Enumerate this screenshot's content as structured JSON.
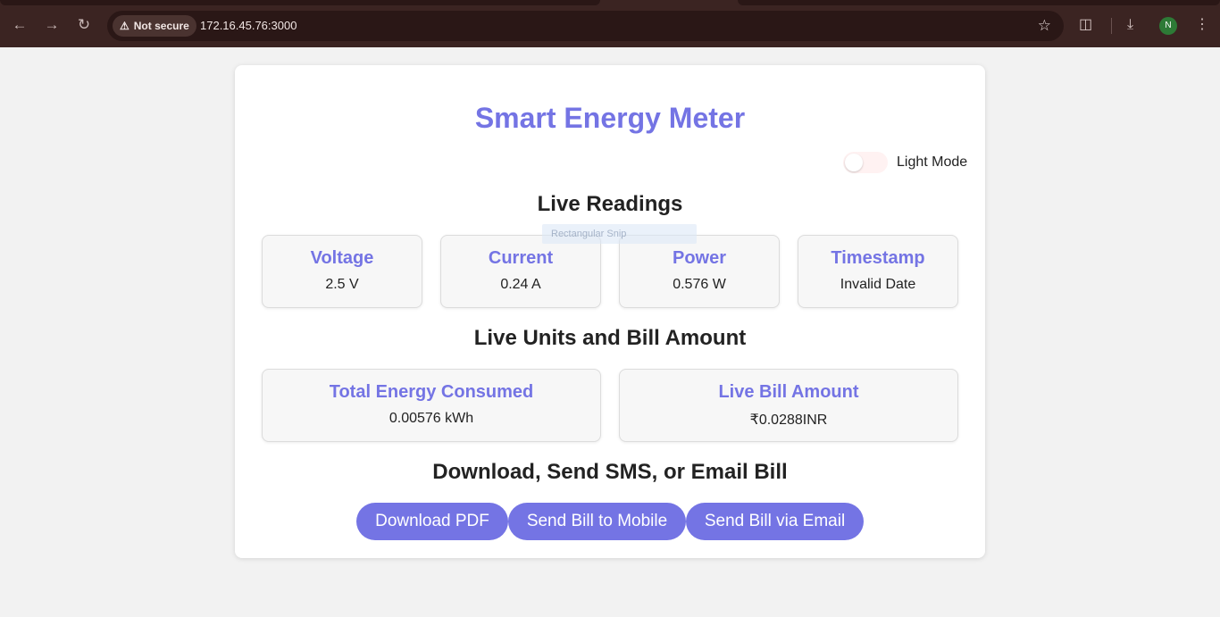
{
  "browser": {
    "security_label": "Not secure",
    "url": "172.16.45.76:3000",
    "profile_initial": "N"
  },
  "page": {
    "title": "Smart Energy Meter",
    "theme_toggle_label": "Light Mode",
    "theme_toggle_on": false,
    "live_readings_heading": "Live Readings",
    "readings": [
      {
        "label": "Voltage",
        "value": "2.5 V"
      },
      {
        "label": "Current",
        "value": "0.24 A"
      },
      {
        "label": "Power",
        "value": "0.576 W"
      },
      {
        "label": "Timestamp",
        "value": "Invalid Date"
      }
    ],
    "units_heading": "Live Units and Bill Amount",
    "summary": [
      {
        "label": "Total Energy Consumed",
        "value": "0.00576 kWh"
      },
      {
        "label": "Live Bill Amount",
        "value": "₹0.0288INR"
      }
    ],
    "actions_heading": "Download, Send SMS, or Email Bill",
    "actions": {
      "download_pdf": "Download PDF",
      "send_mobile": "Send Bill to Mobile",
      "send_email": "Send Bill via Email"
    },
    "overlay_snip_text": "Rectangular Snip"
  },
  "colors": {
    "accent": "#7474e4",
    "chrome_bg": "#3b2422",
    "page_bg": "#f2f2f2"
  }
}
